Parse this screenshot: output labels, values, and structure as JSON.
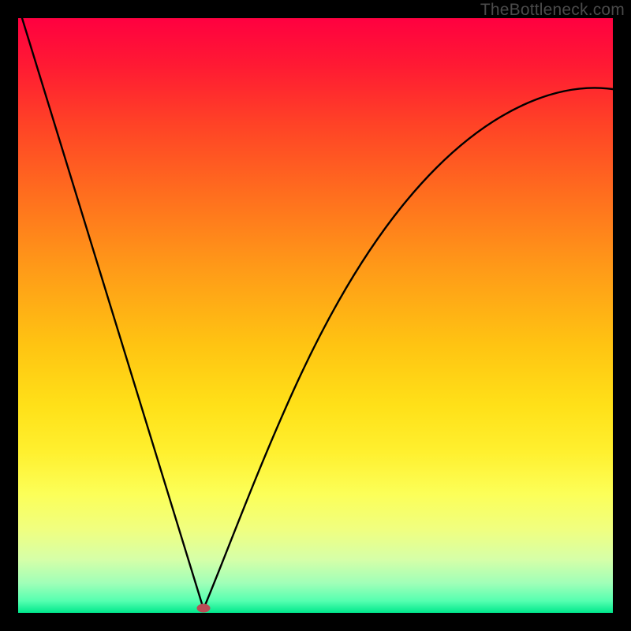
{
  "watermark": "TheBottleneck.com",
  "chart_data": {
    "type": "line",
    "title": "",
    "xlabel": "",
    "ylabel": "",
    "xlim": [
      0,
      1
    ],
    "ylim": [
      0,
      1
    ],
    "x": [
      0.0,
      0.05,
      0.1,
      0.15,
      0.2,
      0.25,
      0.3,
      0.312,
      0.35,
      0.4,
      0.45,
      0.5,
      0.55,
      0.6,
      0.65,
      0.7,
      0.75,
      0.8,
      0.85,
      0.9,
      0.95,
      1.0
    ],
    "y": [
      1.0,
      0.84,
      0.68,
      0.52,
      0.36,
      0.2,
      0.03,
      0.0,
      0.09,
      0.22,
      0.34,
      0.45,
      0.54,
      0.62,
      0.68,
      0.73,
      0.77,
      0.8,
      0.83,
      0.85,
      0.87,
      0.88
    ],
    "minimum_point": {
      "x": 0.312,
      "y": 0.0
    },
    "background_gradient": {
      "top": "#ff0040",
      "bottom": "#00e88c",
      "description": "red-orange-yellow-green vertical gradient"
    },
    "curve_color": "#000000",
    "marker": {
      "x": 0.312,
      "y": 0.007,
      "color": "#bb4a55"
    }
  }
}
